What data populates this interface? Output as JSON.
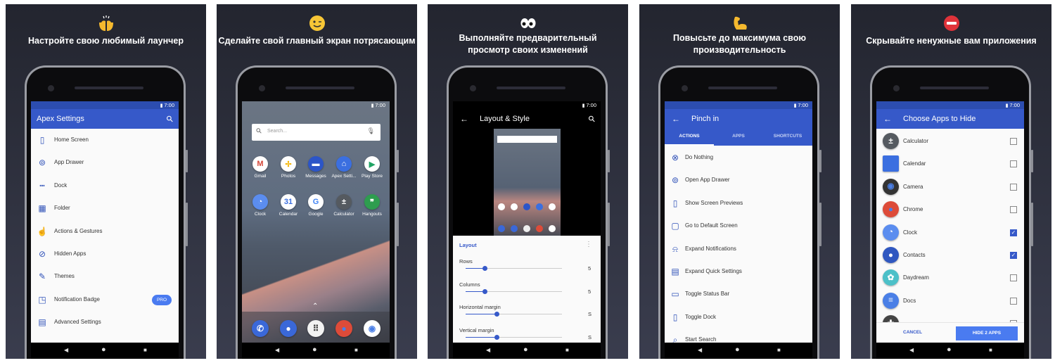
{
  "status_time": "7:00",
  "colors": {
    "primary": "#3659c9",
    "primary_dark": "#2c4db0",
    "accent": "#4a7bf0",
    "panel_bg": "#2b2d3a"
  },
  "panels": [
    {
      "hero_icon": "raising-hands-icon",
      "title": [
        "Настройте свою любимый лаунчер"
      ],
      "screen": {
        "kind": "settings",
        "appbar_title": "Apex Settings",
        "appbar_action_icon": "search-icon",
        "items": [
          {
            "label": "Home Screen",
            "icon": "home-screen-icon"
          },
          {
            "label": "App Drawer",
            "icon": "app-drawer-icon"
          },
          {
            "label": "Dock",
            "icon": "dock-icon"
          },
          {
            "label": "Folder",
            "icon": "folder-icon"
          },
          {
            "label": "Actions & Gestures",
            "icon": "gesture-icon"
          },
          {
            "label": "Hidden Apps",
            "icon": "hidden-eye-icon"
          },
          {
            "label": "Themes",
            "icon": "brush-icon"
          },
          {
            "label": "Notification Badge",
            "icon": "badge-icon",
            "badge": "PRO"
          },
          {
            "label": "Advanced Settings",
            "icon": "advanced-icon"
          }
        ]
      }
    },
    {
      "hero_icon": "winking-face-icon",
      "title": [
        "Сделайте свой главный экран потрясающим"
      ],
      "screen": {
        "kind": "home",
        "search_placeholder": "Search...",
        "apps": [
          {
            "label": "Gmail",
            "icon": "gmail-icon",
            "color": "#ffffff"
          },
          {
            "label": "Photos",
            "icon": "photos-icon",
            "color": "#ffffff"
          },
          {
            "label": "Messages",
            "icon": "messages-icon",
            "color": "#2c55c8"
          },
          {
            "label": "Apex Setti...",
            "icon": "apex-settings-icon",
            "color": "#3b6fe0"
          },
          {
            "label": "Play Store",
            "icon": "play-store-icon",
            "color": "#ffffff"
          },
          {
            "label": "Clock",
            "icon": "clock-icon",
            "color": "#5b8def"
          },
          {
            "label": "Calendar",
            "icon": "calendar-icon",
            "color": "#ffffff"
          },
          {
            "label": "Google",
            "icon": "google-icon",
            "color": "#ffffff"
          },
          {
            "label": "Calculator",
            "icon": "calculator-icon",
            "color": "#555a60"
          },
          {
            "label": "Hangouts",
            "icon": "hangouts-icon",
            "color": "#2e9d4f"
          }
        ],
        "dock": [
          {
            "icon": "phone-icon",
            "color": "#3a68d8"
          },
          {
            "icon": "contacts-icon",
            "color": "#3a68d8"
          },
          {
            "icon": "app-drawer-icon",
            "color": "#f2f2f2"
          },
          {
            "icon": "chrome-icon",
            "color": "#dd4b39"
          },
          {
            "icon": "camera-icon",
            "color": "#ffffff"
          }
        ]
      }
    },
    {
      "hero_icon": "eyes-icon",
      "title": [
        "Выполняйте предварительный",
        "просмотр своих изменений"
      ],
      "screen": {
        "kind": "layout",
        "appbar_title": "Layout & Style",
        "section_title": "Layout",
        "sliders": [
          {
            "label": "Rows",
            "value": "5",
            "fraction": 0.2
          },
          {
            "label": "Columns",
            "value": "5",
            "fraction": 0.2
          },
          {
            "label": "Horizontal margin",
            "value": "S",
            "fraction": 0.32
          },
          {
            "label": "Vertical margin",
            "value": "S",
            "fraction": 0.32
          }
        ]
      }
    },
    {
      "hero_icon": "flexed-biceps-icon",
      "title": [
        "Повысьте до максимума свою",
        "производительность"
      ],
      "screen": {
        "kind": "actions",
        "appbar_title": "Pinch in",
        "tabs": [
          "ACTIONS",
          "APPS",
          "SHORTCUTS"
        ],
        "active_tab": 0,
        "items": [
          {
            "label": "Do Nothing",
            "icon": "cancel-circle-icon"
          },
          {
            "label": "Open App Drawer",
            "icon": "app-drawer-icon"
          },
          {
            "label": "Show Screen Previews",
            "icon": "screen-previews-icon"
          },
          {
            "label": "Go to Default Screen",
            "icon": "default-screen-icon"
          },
          {
            "label": "Expand Notifications",
            "icon": "bell-icon"
          },
          {
            "label": "Expand Quick Settings",
            "icon": "quick-settings-icon"
          },
          {
            "label": "Toggle Status Bar",
            "icon": "status-bar-icon"
          },
          {
            "label": "Toggle Dock",
            "icon": "dock-toggle-icon"
          },
          {
            "label": "Start Search",
            "icon": "search-icon"
          }
        ]
      }
    },
    {
      "hero_icon": "no-entry-icon",
      "title": [
        "Скрывайте ненужные вам приложения"
      ],
      "screen": {
        "kind": "hide",
        "appbar_title": "Choose Apps to Hide",
        "apps": [
          {
            "label": "Calculator",
            "icon": "calculator-icon",
            "color": "#555a60",
            "checked": false
          },
          {
            "label": "Calendar",
            "icon": "calendar-icon",
            "color": "#3b6fe0",
            "checked": false
          },
          {
            "label": "Camera",
            "icon": "camera-icon",
            "color": "#333333",
            "checked": false
          },
          {
            "label": "Chrome",
            "icon": "chrome-icon",
            "color": "#dd4b39",
            "checked": false
          },
          {
            "label": "Clock",
            "icon": "clock-icon",
            "color": "#5b8def",
            "checked": true
          },
          {
            "label": "Contacts",
            "icon": "contacts-icon",
            "color": "#2f57c0",
            "checked": true
          },
          {
            "label": "Daydream",
            "icon": "daydream-icon",
            "color": "#4cc0c8",
            "checked": false
          },
          {
            "label": "Docs",
            "icon": "docs-icon",
            "color": "#4a7fe6",
            "checked": false
          },
          {
            "label": "",
            "icon": "app-icon",
            "color": "#444444",
            "checked": false
          }
        ],
        "cancel_label": "CANCEL",
        "confirm_label": "HIDE 2 APPS"
      }
    }
  ]
}
